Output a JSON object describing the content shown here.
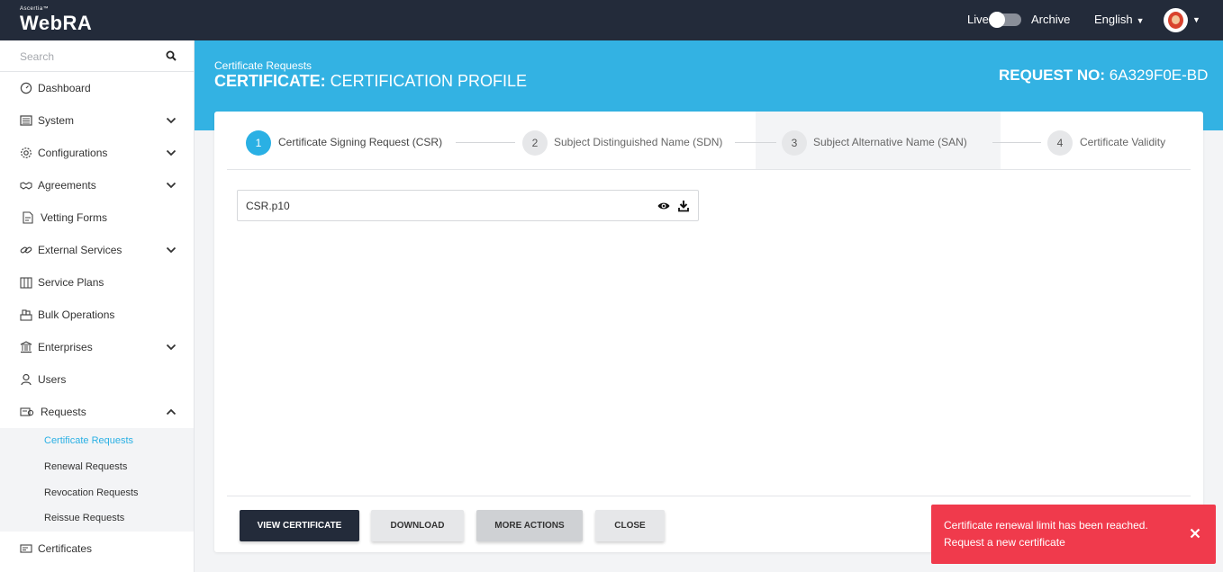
{
  "topbar": {
    "logo_small": "Ascertia™",
    "logo_big": "WebRA",
    "live_label": "Live",
    "archive_label": "Archive",
    "language": "English"
  },
  "sidebar": {
    "search_placeholder": "Search",
    "items": [
      {
        "label": "Dashboard",
        "icon": "dashboard-icon",
        "has_chevron": false
      },
      {
        "label": "System",
        "icon": "system-icon",
        "has_chevron": true
      },
      {
        "label": "Configurations",
        "icon": "gear-icon",
        "has_chevron": true
      },
      {
        "label": "Agreements",
        "icon": "handshake-icon",
        "has_chevron": true
      },
      {
        "label": "Vetting Forms",
        "icon": "form-icon",
        "has_chevron": false
      },
      {
        "label": "External Services",
        "icon": "link-icon",
        "has_chevron": true
      },
      {
        "label": "Service Plans",
        "icon": "plans-icon",
        "has_chevron": false
      },
      {
        "label": "Bulk Operations",
        "icon": "bulk-icon",
        "has_chevron": false
      },
      {
        "label": "Enterprises",
        "icon": "bank-icon",
        "has_chevron": true
      },
      {
        "label": "Users",
        "icon": "user-icon",
        "has_chevron": false
      },
      {
        "label": "Requests",
        "icon": "requests-icon",
        "has_chevron": true,
        "expanded": true
      },
      {
        "label": "Certificates",
        "icon": "certificate-icon",
        "has_chevron": false
      }
    ],
    "sub_items": [
      {
        "label": "Certificate Requests",
        "active": true
      },
      {
        "label": "Renewal Requests",
        "active": false
      },
      {
        "label": "Revocation Requests",
        "active": false
      },
      {
        "label": "Reissue Requests",
        "active": false
      }
    ]
  },
  "header": {
    "breadcrumb": "Certificate Requests",
    "title_bold": "CERTIFICATE:",
    "title_rest": "CERTIFICATION PROFILE",
    "request_label": "REQUEST NO:",
    "request_value": "6A329F0E-BD"
  },
  "steps": [
    {
      "number": "1",
      "label": "Certificate Signing Request (CSR)",
      "active": true
    },
    {
      "number": "2",
      "label": "Subject Distinguished Name (SDN)",
      "active": false
    },
    {
      "number": "3",
      "label": "Subject Alternative Name (SAN)",
      "active": false
    },
    {
      "number": "4",
      "label": "Certificate Validity",
      "active": false
    }
  ],
  "file": {
    "name": "CSR.p10"
  },
  "buttons": {
    "view_certificate": "VIEW CERTIFICATE",
    "download": "DOWNLOAD",
    "more_actions": "MORE ACTIONS",
    "close": "CLOSE"
  },
  "toast": {
    "line1": "Certificate renewal limit has been reached.",
    "line2": "Request a new certificate"
  },
  "colors": {
    "topbar": "#232b3a",
    "accent": "#33b2e3",
    "toast": "#f03a4c"
  }
}
